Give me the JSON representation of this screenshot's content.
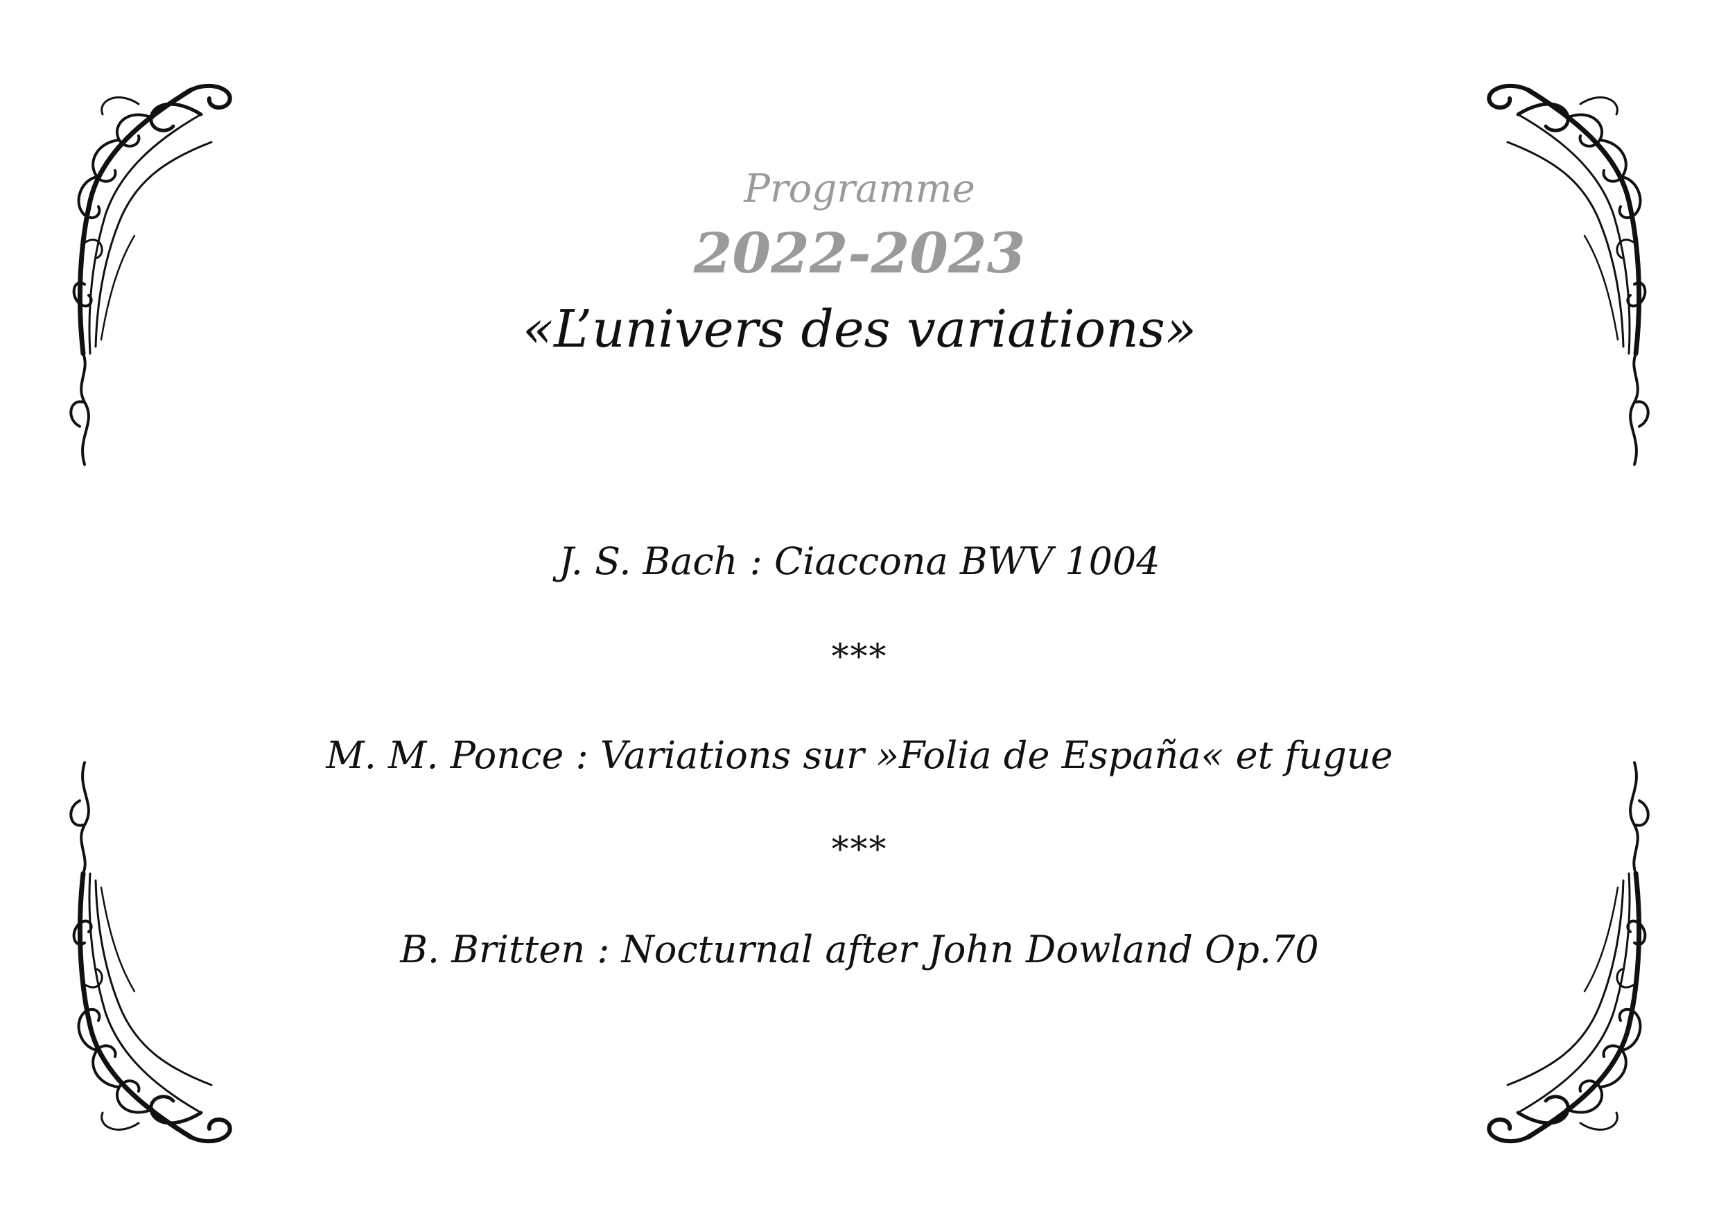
{
  "header": {
    "label": "Programme",
    "season": "2022-2023",
    "title": "«L’univers des variations»"
  },
  "program": [
    {
      "text": "J. S. Bach :  Ciaccona BWV 1004"
    },
    {
      "text": "M. M. Ponce :  Variations sur »Folia de España« et fugue"
    },
    {
      "text": "B. Britten :  Nocturnal after John Dowland Op.70"
    }
  ],
  "separator": "***",
  "colors": {
    "muted_text": "#9a9a9a",
    "main_text": "#111111",
    "ornament": "#111111"
  },
  "icons": {
    "corner": "art-nouveau-corner-ornament-icon"
  }
}
